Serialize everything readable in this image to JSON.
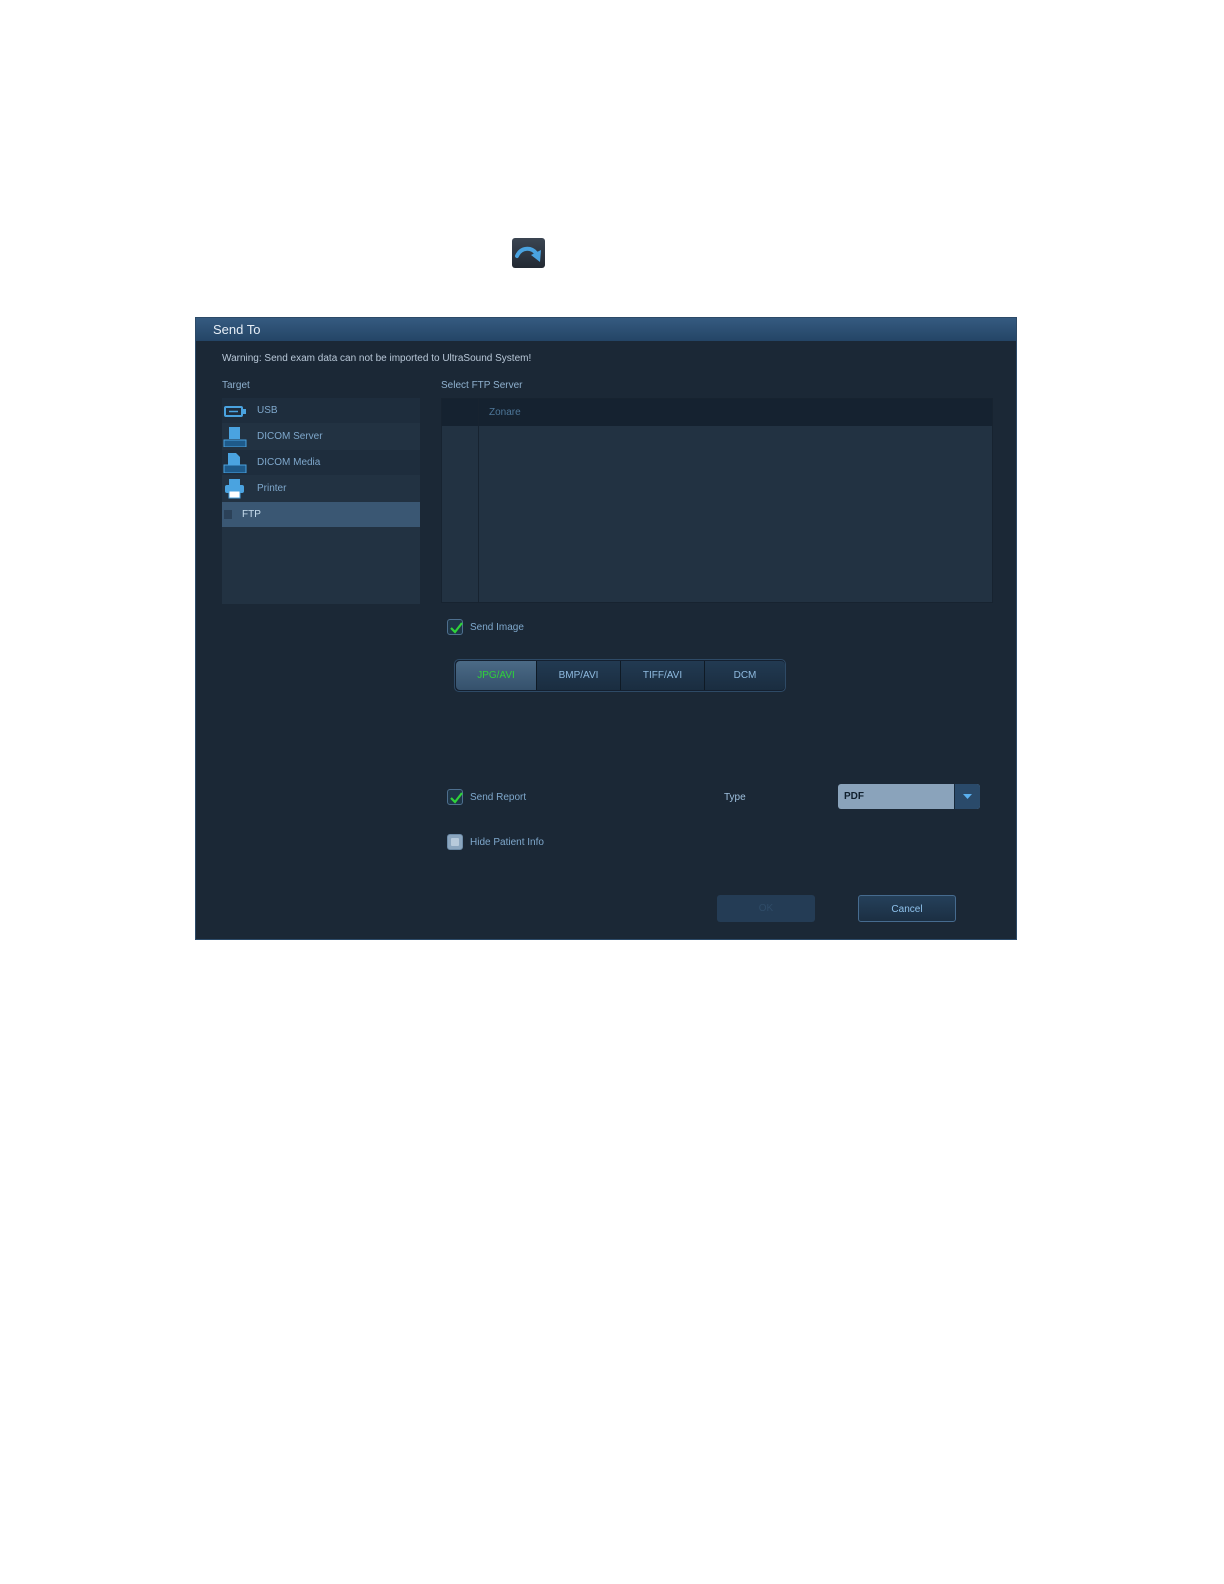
{
  "toolbar": {
    "send_icon": "send-to-arrow-icon"
  },
  "dialog": {
    "title": "Send To",
    "warning": "Warning: Send exam data can not be imported to UltraSound System!",
    "target_label": "Target",
    "targets": [
      {
        "label": "USB",
        "icon": "usb-icon",
        "selected": false
      },
      {
        "label": "DICOM Server",
        "icon": "dicom-server-icon",
        "selected": false
      },
      {
        "label": "DICOM Media",
        "icon": "dicom-media-icon",
        "selected": false
      },
      {
        "label": "Printer",
        "icon": "printer-icon",
        "selected": false
      },
      {
        "label": "FTP",
        "icon": "",
        "selected": true
      }
    ],
    "server_label": "Select FTP Server",
    "server_columns": [
      "",
      "Zonare"
    ],
    "send_image": {
      "label": "Send Image",
      "checked": true
    },
    "formats": [
      {
        "label": "JPG/AVI",
        "active": true
      },
      {
        "label": "BMP/AVI",
        "active": false
      },
      {
        "label": "TIFF/AVI",
        "active": false
      },
      {
        "label": "DCM",
        "active": false
      }
    ],
    "send_report": {
      "label": "Send Report",
      "checked": true
    },
    "type_label": "Type",
    "type_value": "PDF",
    "hide_patient": {
      "label": "Hide Patient Info",
      "checked": false
    },
    "ok_label": "OK",
    "cancel_label": "Cancel"
  },
  "colors": {
    "dialog_bg": "#1b2836",
    "title_bar": "#2c4f74",
    "check_green": "#2fd33a",
    "accent_text": "#7fa8cc"
  }
}
